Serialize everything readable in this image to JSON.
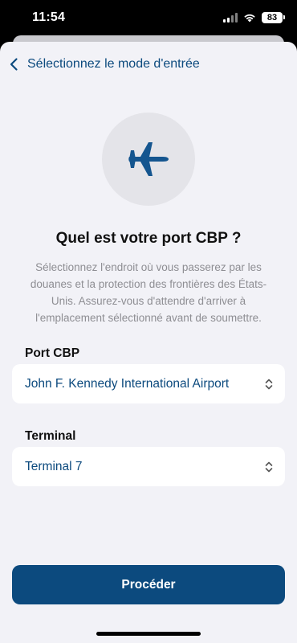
{
  "status_bar": {
    "time": "11:54",
    "battery": "83"
  },
  "nav": {
    "back_label": "Sélectionnez le mode d'entrée"
  },
  "hero": {
    "icon": "airplane-icon"
  },
  "content": {
    "title": "Quel est votre port CBP ?",
    "description": "Sélectionnez l'endroit où vous passerez par les douanes et la protection des frontières des États-Unis. Assurez-vous d'attendre d'arriver à l'emplacement sélectionné avant de soumettre."
  },
  "port_field": {
    "label": "Port CBP",
    "value": "John F. Kennedy International Airport"
  },
  "terminal_field": {
    "label": "Terminal",
    "value": "Terminal 7"
  },
  "actions": {
    "proceed_label": "Procéder"
  },
  "colors": {
    "primary": "#0c4a7e",
    "background": "#f2f2f7",
    "secondary_text": "#8e8e93"
  }
}
